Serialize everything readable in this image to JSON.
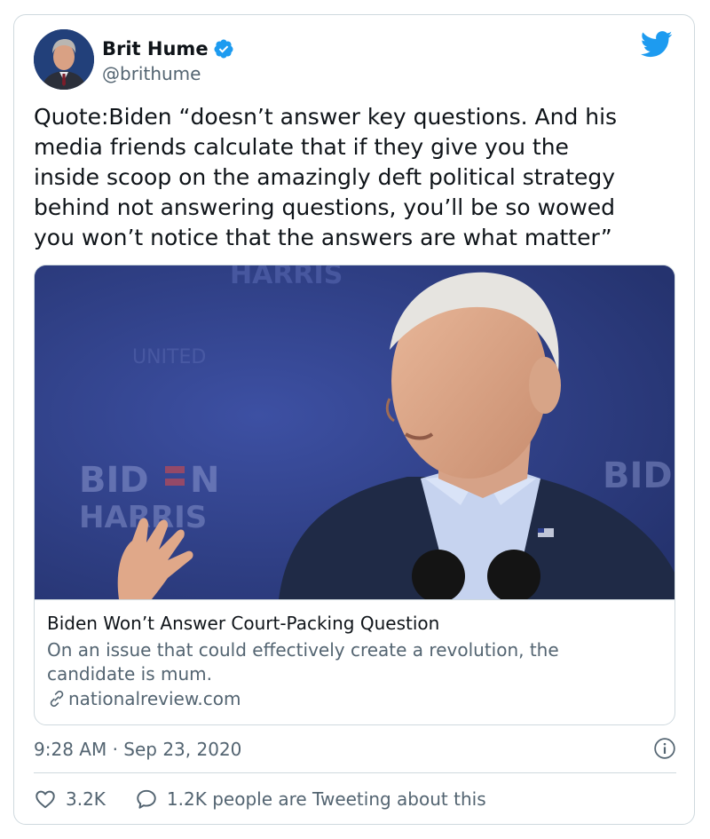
{
  "author": {
    "display_name": "Brit Hume",
    "handle": "@brithume",
    "verified": true
  },
  "tweet": {
    "text": "Quote:Biden “doesn’t answer key questions. And his\nmedia friends calculate that if they give you the\ninside scoop on the amazingly deft political strategy\nbehind not answering questions, you’ll be so wowed\nyou won’t notice that the answers are what matter”"
  },
  "link_card": {
    "title": "Biden Won’t Answer Court-Packing Question",
    "description": "On an issue that could effectively create a revolution, the candidate is mum.",
    "domain": "nationalreview.com",
    "image_signage": [
      "BID",
      "N",
      "HARRIS",
      "BID"
    ]
  },
  "meta": {
    "timestamp": "9:28 AM · Sep 23, 2020"
  },
  "engagement": {
    "likes": "3.2K",
    "tweeting_about": "1.2K people are Tweeting about this"
  },
  "colors": {
    "brand_blue": "#1d9bf0",
    "text_primary": "#0f1419",
    "text_secondary": "#536471",
    "border": "#cfd9de",
    "backdrop_blue": "#2f3f86"
  },
  "icons": {
    "verified": "verified-badge-icon",
    "twitter": "twitter-bird-icon",
    "link": "link-icon",
    "info": "info-icon",
    "like": "heart-icon",
    "reply": "speech-bubble-icon"
  }
}
